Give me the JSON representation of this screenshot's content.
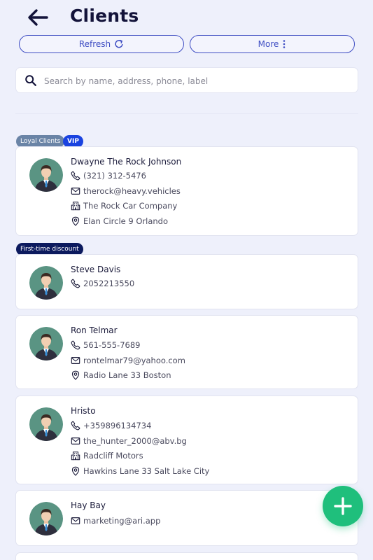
{
  "header": {
    "title": "Clients"
  },
  "toolbar": {
    "refresh_label": "Refresh",
    "more_label": "More"
  },
  "search": {
    "placeholder": "Search by name, address, phone, label"
  },
  "badges": {
    "loyal": "Loyal Clients",
    "vip": "VIP",
    "first_time": "First-time discount"
  },
  "clients": [
    {
      "name": "Dwayne The Rock Johnson",
      "phone": "(321) 312-5476",
      "email": "therock@heavy.vehicles",
      "company": "The Rock Car Company",
      "address": "Elan Circle 9 Orlando"
    },
    {
      "name": "Steve Davis",
      "phone": "2052213550"
    },
    {
      "name": "Ron Telmar",
      "phone": "561-555-7689",
      "email": "rontelmar79@yahoo.com",
      "address": "Radio Lane 33 Boston"
    },
    {
      "name": "Hristo",
      "phone": "+359896134734",
      "email": "the_hunter_2000@abv.bg",
      "company": "Radcliff Motors",
      "address": "Hawkins Lane 33 Salt Lake City"
    },
    {
      "name": "Hay Bay",
      "email": "marketing@ari.app"
    }
  ],
  "icons": {
    "back": "arrow-left-icon",
    "refresh": "refresh-icon",
    "more": "more-vertical-icon",
    "search": "search-icon",
    "phone": "phone-icon",
    "email": "mail-icon",
    "company": "building-icon",
    "address": "map-pin-icon",
    "add": "plus-icon"
  },
  "colors": {
    "accent": "#3f4ec3",
    "fab": "#1fbf7c",
    "background": "#eef0fb",
    "vip": "#1a43e0",
    "loyal": "#6a84a6",
    "first_time": "#0c1a5e"
  }
}
